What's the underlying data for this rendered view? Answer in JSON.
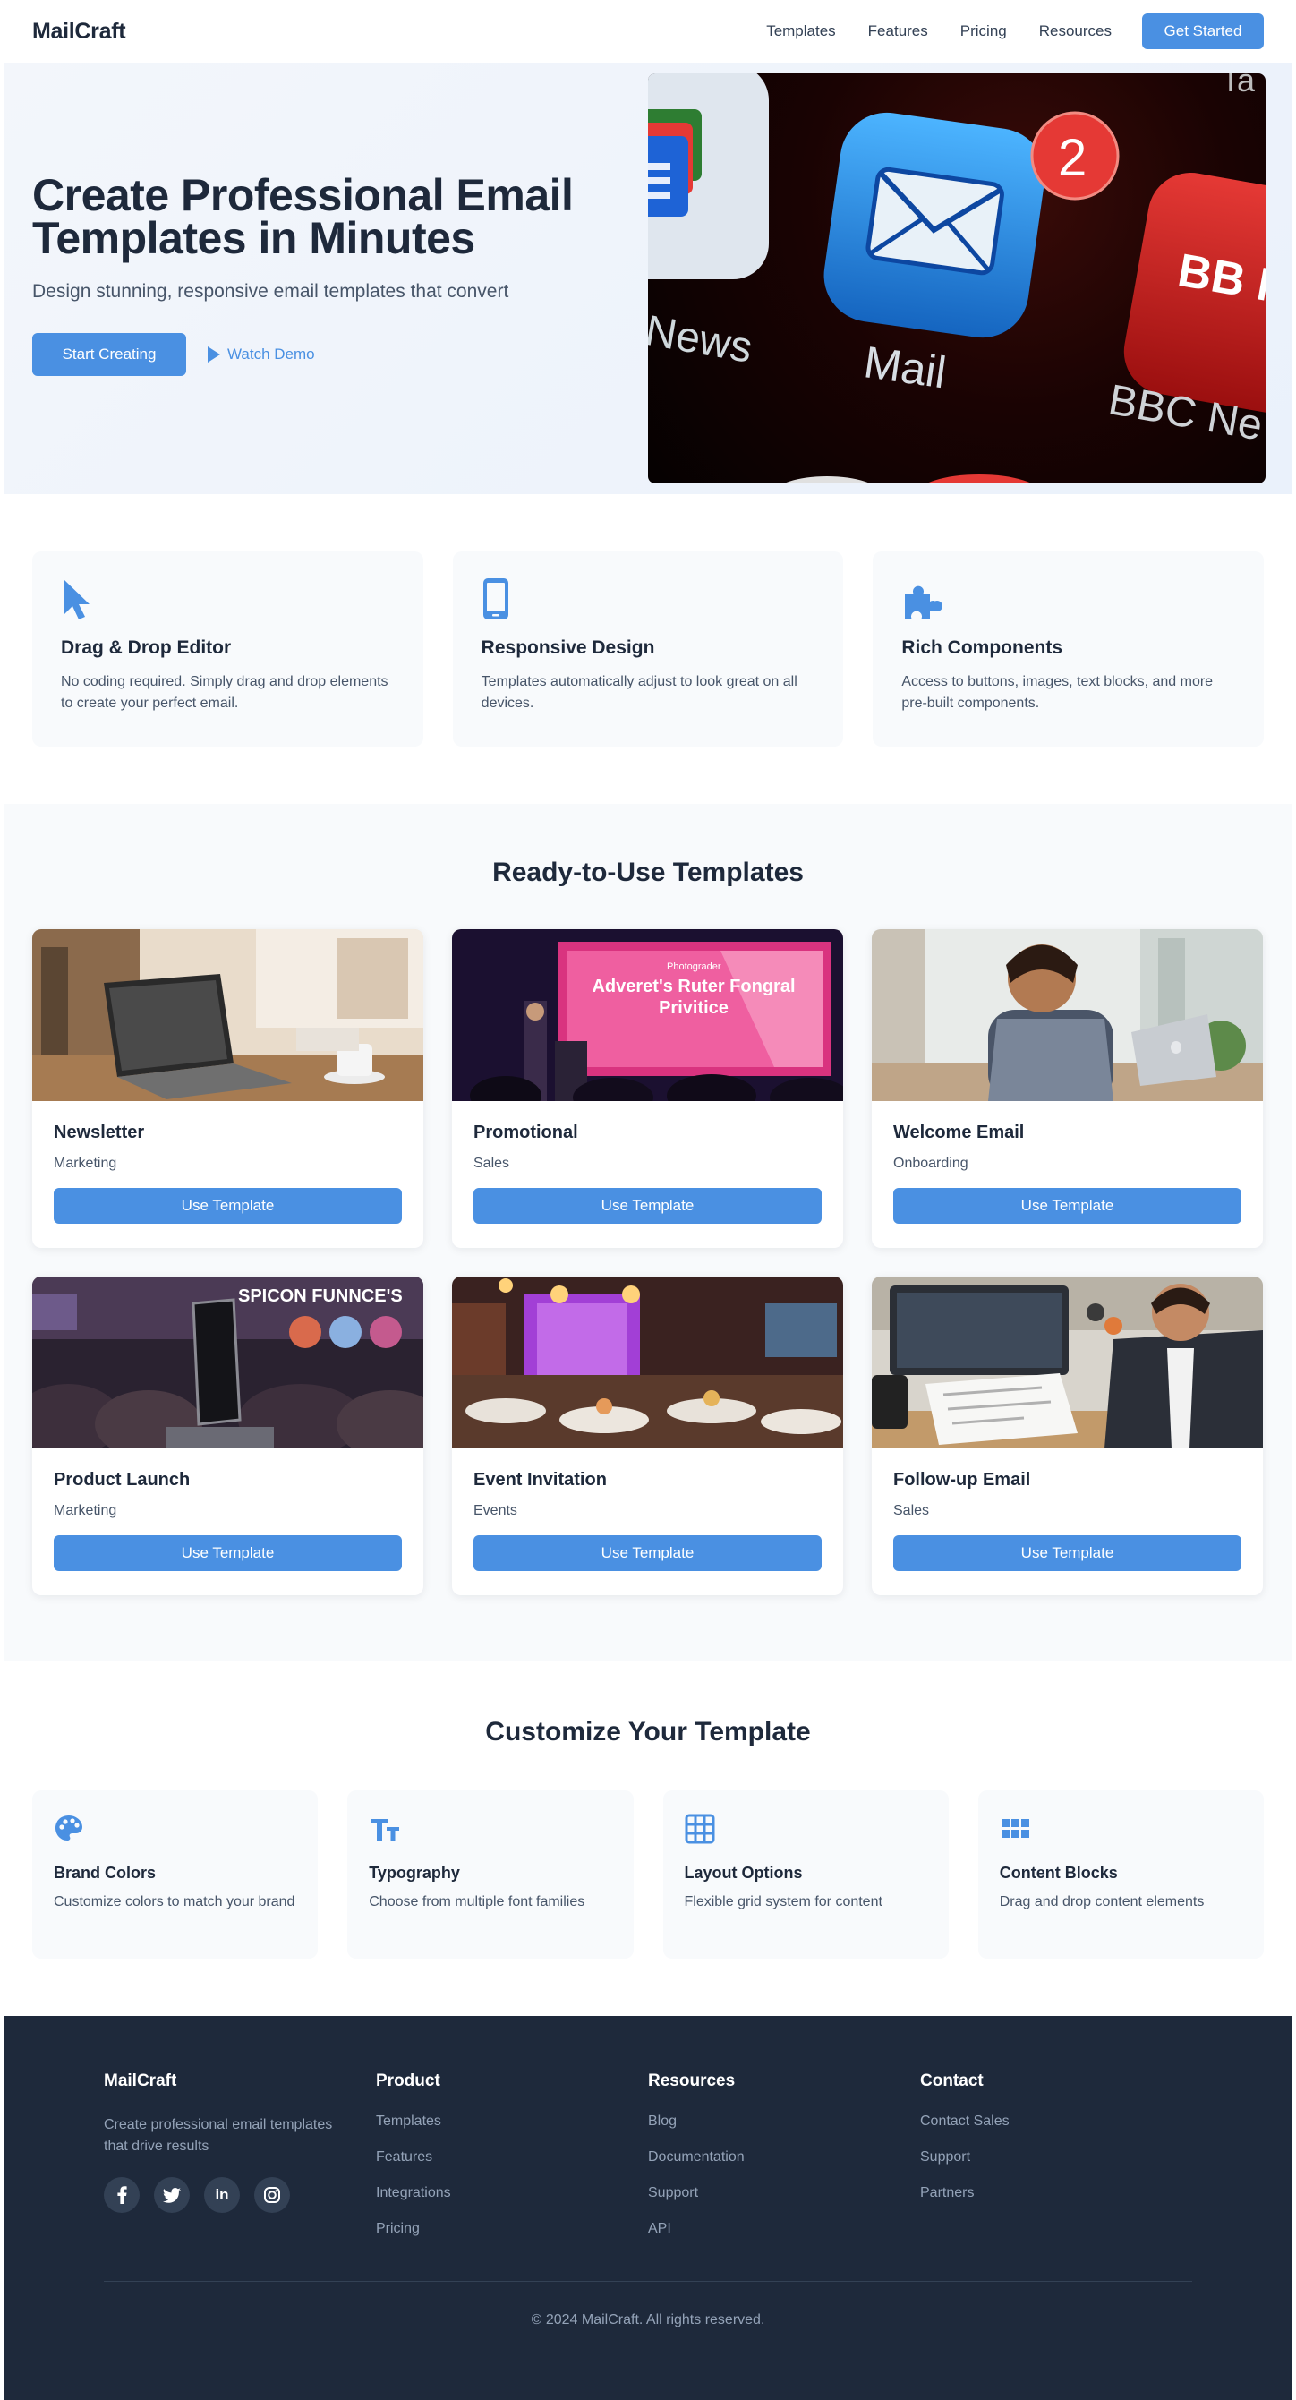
{
  "nav": {
    "logo": "MailCraft",
    "links": [
      "Templates",
      "Features",
      "Pricing",
      "Resources"
    ],
    "cta": "Get Started"
  },
  "hero": {
    "title": "Create Professional Email Templates in Minutes",
    "subtitle": "Design stunning, responsive email templates that convert",
    "primary_button": "Start Creating",
    "secondary_button": "Watch Demo",
    "image": {
      "app_label_left": "News",
      "app_label_center": "Mail",
      "badge_count": "2",
      "app_label_right": "BBC Ne",
      "tile_text_right": "BB NEW",
      "top_corner_text": "Ta"
    }
  },
  "features": [
    {
      "icon": "cursor-icon",
      "title": "Drag & Drop Editor",
      "desc": "No coding required. Simply drag and drop elements to create your perfect email."
    },
    {
      "icon": "mobile-icon",
      "title": "Responsive Design",
      "desc": "Templates automatically adjust to look great on all devices."
    },
    {
      "icon": "puzzle-icon",
      "title": "Rich Components",
      "desc": "Access to buttons, images, text blocks, and more pre-built components."
    }
  ],
  "templates": {
    "title": "Ready-to-Use Templates",
    "button_label": "Use Template",
    "items": [
      {
        "name": "Newsletter",
        "category": "Marketing"
      },
      {
        "name": "Promotional",
        "category": "Sales",
        "image_text": "Adveret's Ruter Fongral Privitice",
        "image_brand": "Photograder"
      },
      {
        "name": "Welcome Email",
        "category": "Onboarding"
      },
      {
        "name": "Product Launch",
        "category": "Marketing",
        "image_text": "SPICON FUNNCE'S"
      },
      {
        "name": "Event Invitation",
        "category": "Events"
      },
      {
        "name": "Follow-up Email",
        "category": "Sales"
      }
    ]
  },
  "customize": {
    "title": "Customize Your Template",
    "items": [
      {
        "icon": "palette-icon",
        "title": "Brand Colors",
        "desc": "Customize colors to match your brand"
      },
      {
        "icon": "typography-icon",
        "title": "Typography",
        "desc": "Choose from multiple font families"
      },
      {
        "icon": "grid-icon",
        "title": "Layout Options",
        "desc": "Flexible grid system for content"
      },
      {
        "icon": "blocks-icon",
        "title": "Content Blocks",
        "desc": "Drag and drop content elements"
      }
    ]
  },
  "footer": {
    "brand": "MailCraft",
    "tagline": "Create professional email templates that drive results",
    "socials": [
      "facebook-icon",
      "twitter-icon",
      "linkedin-icon",
      "instagram-icon"
    ],
    "social_labels": {
      "linkedin": "in"
    },
    "columns": [
      {
        "title": "Product",
        "links": [
          "Templates",
          "Features",
          "Integrations",
          "Pricing"
        ]
      },
      {
        "title": "Resources",
        "links": [
          "Blog",
          "Documentation",
          "Support",
          "API"
        ]
      },
      {
        "title": "Contact",
        "links": [
          "Contact Sales",
          "Support",
          "Partners"
        ]
      }
    ],
    "copyright": "© 2024 MailCraft. All rights reserved."
  },
  "colors": {
    "accent": "#4a90e2",
    "heading": "#1e293b",
    "body_text": "#475569",
    "card_bg": "#f8fafc",
    "footer_bg": "#1e293b"
  }
}
